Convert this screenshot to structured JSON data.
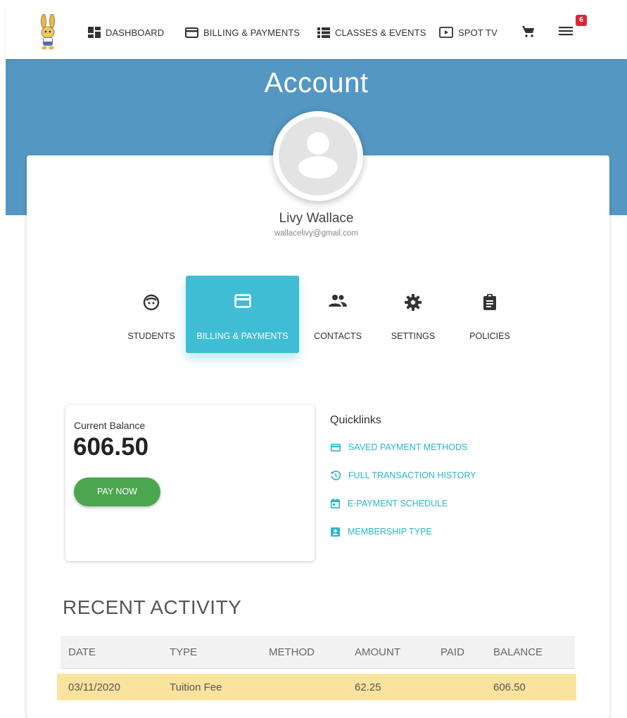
{
  "nav": {
    "items": [
      {
        "label": "DASHBOARD",
        "icon": "dashboard-icon"
      },
      {
        "label": "BILLING & PAYMENTS",
        "icon": "credit-card-icon"
      },
      {
        "label": "CLASSES & EVENTS",
        "icon": "list-icon"
      },
      {
        "label": "SPOT TV",
        "icon": "play-screen-icon"
      }
    ],
    "cart_icon": "cart-icon",
    "menu_icon": "hamburger-menu-icon",
    "badge": "6"
  },
  "page": {
    "title": "Account",
    "header_color": "#5497c2"
  },
  "user": {
    "name": "Livy Wallace",
    "email": "wallacelivy@gmail.com"
  },
  "tabs": [
    {
      "label": "STUDENTS",
      "icon": "face-icon",
      "active": false
    },
    {
      "label": "BILLING & PAYMENTS",
      "icon": "credit-card-icon",
      "active": true
    },
    {
      "label": "CONTACTS",
      "icon": "people-icon",
      "active": false
    },
    {
      "label": "SETTINGS",
      "icon": "gear-icon",
      "active": false
    },
    {
      "label": "POLICIES",
      "icon": "clipboard-icon",
      "active": false
    }
  ],
  "balance": {
    "label": "Current Balance",
    "value": "606.50",
    "pay_button": "PAY NOW",
    "pay_color": "#4aa64f"
  },
  "quicklinks": {
    "title": "Quicklinks",
    "items": [
      {
        "label": "SAVED PAYMENT METHODS",
        "icon": "credit-card-icon"
      },
      {
        "label": "FULL TRANSACTION HISTORY",
        "icon": "history-icon"
      },
      {
        "label": "E-PAYMENT SCHEDULE",
        "icon": "calendar-icon"
      },
      {
        "label": "MEMBERSHIP TYPE",
        "icon": "badge-icon"
      }
    ],
    "link_color": "#2bb5ce"
  },
  "recent_activity": {
    "title": "RECENT ACTIVITY",
    "columns": [
      "DATE",
      "TYPE",
      "METHOD",
      "AMOUNT",
      "PAID",
      "BALANCE"
    ],
    "rows": [
      {
        "date": "03/11/2020",
        "type": "Tuition Fee",
        "method": "",
        "amount": "62.25",
        "paid": "",
        "balance": "606.50"
      }
    ],
    "highlight_color": "#fae39c"
  }
}
